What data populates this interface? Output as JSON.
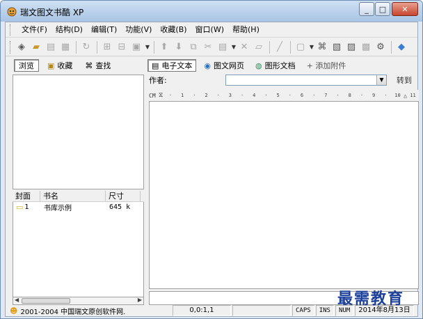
{
  "window": {
    "title": "瑞文图文书酷 XP"
  },
  "menubar": {
    "items": [
      "文件(F)",
      "结构(D)",
      "编辑(T)",
      "功能(V)",
      "收藏(B)",
      "窗口(W)",
      "帮助(H)"
    ]
  },
  "toolbar": {
    "icons": [
      "tag-icon",
      "open-folder-icon",
      "edit-icon",
      "print-icon",
      "refresh-icon",
      "insert-icon",
      "remove-icon",
      "save-icon",
      "arrow-up-icon",
      "arrow-down-icon",
      "copy-icon",
      "cut-icon",
      "paste-icon",
      "delete-icon",
      "eraser-icon",
      "pencil-icon",
      "page-icon",
      "binoculars-icon",
      "image-icon",
      "doc-icon",
      "photo-icon",
      "settings-icon",
      "help-icon"
    ]
  },
  "left_tabs": [
    {
      "label": "浏览",
      "icon": "browse-icon",
      "active": true
    },
    {
      "label": "收藏",
      "icon": "favorite-icon",
      "active": false
    },
    {
      "label": "查找",
      "icon": "binoculars-icon",
      "active": false
    }
  ],
  "book_list": {
    "columns": [
      "封面",
      "书名",
      "尺寸"
    ],
    "rows": [
      {
        "cover": "1",
        "name": "书库示例",
        "size": "645 k"
      }
    ]
  },
  "right_tabs": [
    {
      "label": "电子文本",
      "icon": "text-doc-icon",
      "active": true
    },
    {
      "label": "图文网页",
      "icon": "webpage-icon",
      "active": false
    },
    {
      "label": "图形文档",
      "icon": "graphic-doc-icon",
      "active": false
    },
    {
      "label": "+ 添加附件",
      "icon": "",
      "active": false
    }
  ],
  "author": {
    "label": "作者:",
    "value": "",
    "goto_label": "转到"
  },
  "ruler": {
    "unit": "CM",
    "ticks": [
      "·",
      "1",
      "·",
      "2",
      "·",
      "3",
      "·",
      "4",
      "·",
      "5",
      "·",
      "6",
      "·",
      "7",
      "·",
      "8",
      "·",
      "9",
      "·",
      "10",
      "11"
    ]
  },
  "statusbar": {
    "copyright": "2001-2004 中国瑞文原创软件网.",
    "position": "0,0:1,1",
    "caps": "CAPS",
    "ins": "INS",
    "num": "NUM",
    "date": "2014年8月13日"
  },
  "watermark": "最需教育"
}
